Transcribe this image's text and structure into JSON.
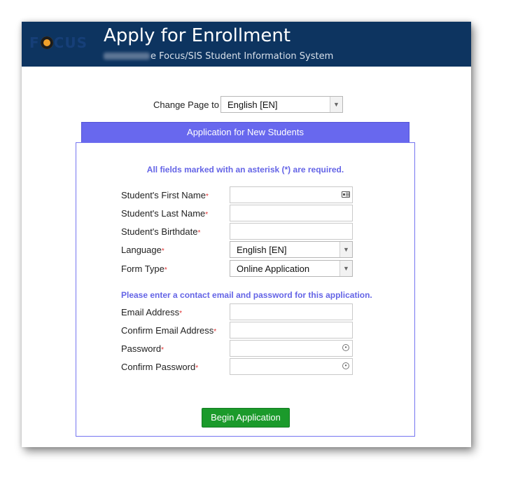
{
  "header": {
    "logo_text": "FOCUS",
    "title": "Apply for Enrollment",
    "subtitle": "e Focus/SIS Student Information System"
  },
  "change_page": {
    "label": "Change Page to",
    "selected": "English [EN]"
  },
  "tab": {
    "label": "Application for New Students"
  },
  "form": {
    "required_note": "All fields marked with an asterisk (*) are required.",
    "contact_note": "Please enter a contact email and password for this application.",
    "asterisk": "*",
    "fields": {
      "first_name": {
        "label": "Student's First Name",
        "value": ""
      },
      "last_name": {
        "label": "Student's Last Name",
        "value": ""
      },
      "birthdate": {
        "label": "Student's Birthdate",
        "value": ""
      },
      "language": {
        "label": "Language",
        "selected": "English [EN]"
      },
      "form_type": {
        "label": "Form Type",
        "selected": "Online Application"
      },
      "email": {
        "label": "Email Address",
        "value": ""
      },
      "confirm_email": {
        "label": "Confirm Email Address",
        "value": ""
      },
      "password": {
        "label": "Password",
        "value": ""
      },
      "confirm_password": {
        "label": "Confirm Password",
        "value": ""
      }
    },
    "submit_label": "Begin Application"
  },
  "icons": {
    "contact_card": "contact-card-icon",
    "password_reveal": "password-reveal-icon",
    "dropdown": "chevron-down-icon"
  },
  "colors": {
    "header_bg": "#0d3460",
    "tab_bg": "#6868ee",
    "note_text": "#6464e6",
    "required_asterisk": "#e03030",
    "submit_bg": "#1b9a2b"
  }
}
